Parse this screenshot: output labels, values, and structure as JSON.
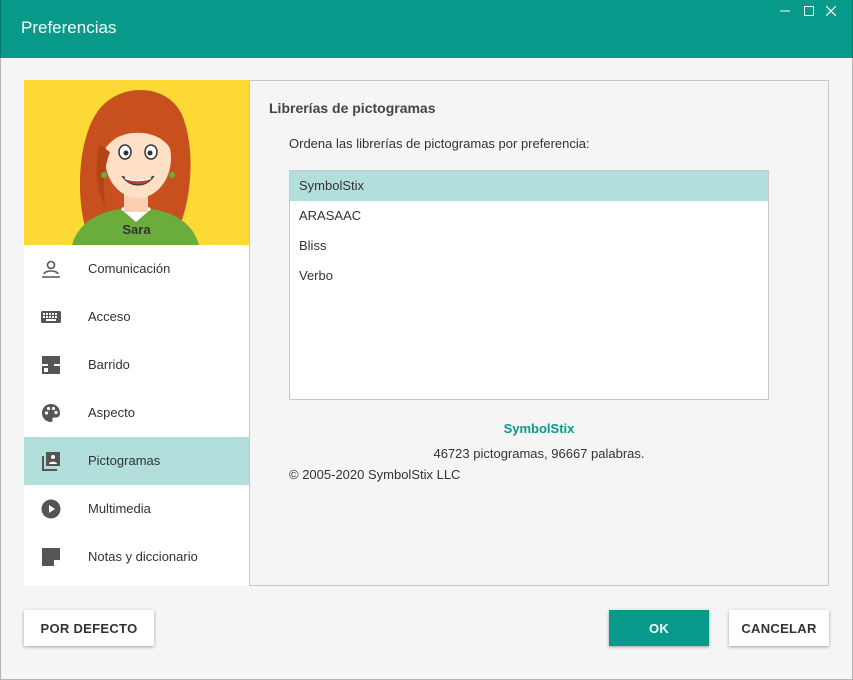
{
  "window": {
    "title": "Preferencias",
    "controls": [
      "minimize-icon",
      "maximize-icon",
      "close-icon"
    ]
  },
  "user": {
    "name": "Sara"
  },
  "sidebar": {
    "items": [
      {
        "label": "Comunicación",
        "icon": "person-speak-icon"
      },
      {
        "label": "Acceso",
        "icon": "keyboard-icon"
      },
      {
        "label": "Barrido",
        "icon": "scan-icon"
      },
      {
        "label": "Aspecto",
        "icon": "palette-icon"
      },
      {
        "label": "Pictogramas",
        "icon": "pictogram-library-icon",
        "active": true
      },
      {
        "label": "Multimedia",
        "icon": "play-circle-icon"
      },
      {
        "label": "Notas y diccionario",
        "icon": "note-icon"
      }
    ]
  },
  "main": {
    "section_title": "Librerías de pictogramas",
    "instruction": "Ordena las librerías de pictogramas por preferencia:",
    "libraries": [
      "SymbolStix",
      "ARASAAC",
      "Bliss",
      "Verbo"
    ],
    "selected_library": "SymbolStix",
    "details": {
      "name": "SymbolStix",
      "stats": "46723 pictogramas, 96667 palabras.",
      "copyright": "© 2005-2020 SymbolStix LLC"
    }
  },
  "buttons": {
    "default_label": "POR DEFECTO",
    "ok_label": "OK",
    "cancel_label": "CANCELAR"
  },
  "colors": {
    "accent": "#079a8a",
    "selection": "#b2dfdb",
    "avatar_background": "#fcd934"
  }
}
